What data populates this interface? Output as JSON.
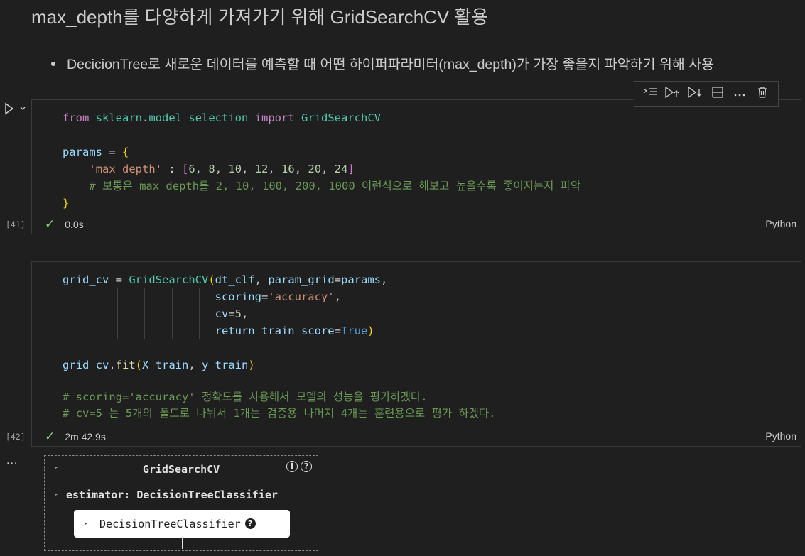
{
  "markdown": {
    "title": "max_depth를 다양하게 가져가기 위해 GridSearchCV 활용",
    "bullet": "DecicionTree로 새로운 데이터를 예측할 때 어떤 하이퍼파라미터(max_depth)가 가장 좋을지 파악하기 위해 사용"
  },
  "toolbar": {
    "icons": [
      "run-above-icon",
      "run-cell-icon",
      "run-below-icon",
      "split-cell-icon",
      "more-icon",
      "delete-icon"
    ]
  },
  "cell1": {
    "exec_count": "[41]",
    "status_time": "0.0s",
    "language": "Python",
    "code": {
      "l1_kw1": "from",
      "l1_mod": "sklearn",
      "l1_dot": ".",
      "l1_mod2": "model_selection",
      "l1_kw2": "import",
      "l1_cls": "GridSearchCV",
      "l3_var": "params",
      "l3_eq": " = ",
      "l3_brace": "{",
      "l4_key": "'max_depth'",
      "l4_colon": " : ",
      "l4_open": "[",
      "l4_vals": [
        "6",
        "8",
        "10",
        "12",
        "16",
        "20",
        "24"
      ],
      "l4_close": "]",
      "l5_comment": "# 보통은 max_depth를 2, 10, 100, 200, 1000 이런식으로 해보고 높을수록 좋이지는지 파악",
      "l6_brace": "}"
    }
  },
  "cell2": {
    "exec_count": "[42]",
    "status_time": "2m 42.9s",
    "language": "Python",
    "code": {
      "l1_var": "grid_cv",
      "l1_eq": " = ",
      "l1_cls": "GridSearchCV",
      "l1_open": "(",
      "l1_arg1": "dt_clf",
      "l1_comma": ", ",
      "l1_arg2": "param_grid",
      "l1_eq2": "=",
      "l1_arg3": "params",
      "l1_end": ",",
      "l2_arg": "scoring",
      "l2_eq": "=",
      "l2_val": "'accuracy'",
      "l2_end": ",",
      "l3_arg": "cv",
      "l3_eq": "=",
      "l3_val": "5",
      "l3_end": ",",
      "l4_arg": "return_train_score",
      "l4_eq": "=",
      "l4_val": "True",
      "l4_close": ")",
      "l6_var": "grid_cv",
      "l6_dot": ".",
      "l6_fn": "fit",
      "l6_open": "(",
      "l6_a1": "X_train",
      "l6_comma": ", ",
      "l6_a2": "y_train",
      "l6_close": ")",
      "l8_comment": "# scoring='accuracy' 정확도를 사용해서 모델의 성능을 평가하겠다.",
      "l9_comment": "# cv=5 는 5개의 폴드로 나눠서 1개는 검증용 나머지 4개는 훈련용으로 평가 하겠다."
    }
  },
  "output": {
    "more": "...",
    "widget_title": "GridSearchCV",
    "info_glyph": "i",
    "help_glyph": "?",
    "estimator_label": "estimator: DecisionTreeClassifier",
    "box_label": "DecisionTreeClassifier",
    "box_help": "?",
    "arrow": "▸"
  }
}
